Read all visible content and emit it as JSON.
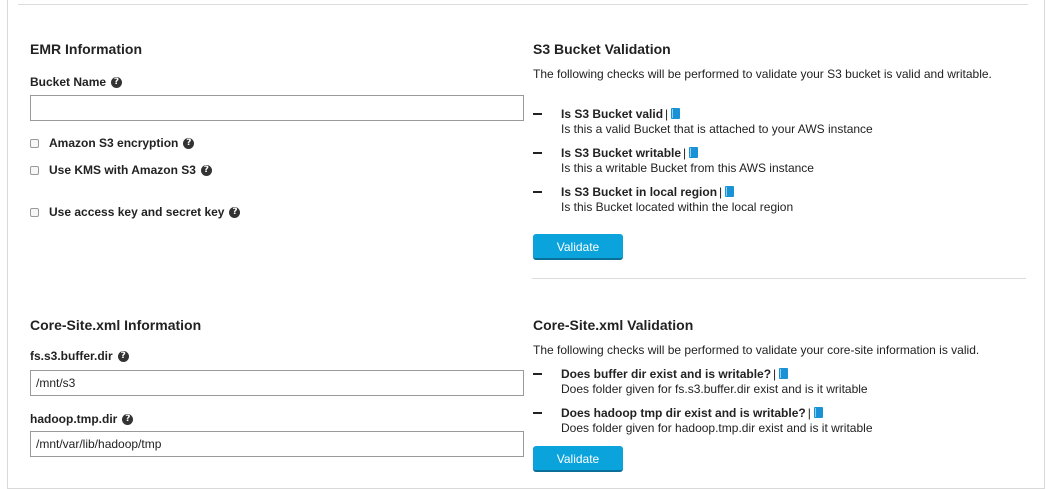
{
  "emr": {
    "title": "EMR Information",
    "bucket_name_label": "Bucket Name",
    "bucket_name_value": "",
    "checkboxes": [
      {
        "label": "Amazon S3 encryption",
        "checked": false
      },
      {
        "label": "Use KMS with Amazon S3",
        "checked": false
      },
      {
        "label": "Use access key and secret key",
        "checked": false
      }
    ]
  },
  "s3_validation": {
    "title": "S3 Bucket Validation",
    "intro": "The following checks will be performed to validate your S3 bucket is valid and writable.",
    "checks": [
      {
        "title": "Is S3 Bucket valid",
        "desc": "Is this a valid Bucket that is attached to your AWS instance"
      },
      {
        "title": "Is S3 Bucket writable",
        "desc": "Is this a writable Bucket from this AWS instance"
      },
      {
        "title": "Is S3 Bucket in local region",
        "desc": "Is this Bucket located within the local region"
      }
    ],
    "button": "Validate"
  },
  "core_site": {
    "title": "Core-Site.xml Information",
    "buffer_label": "fs.s3.buffer.dir",
    "buffer_value": "/mnt/s3",
    "tmp_label": "hadoop.tmp.dir",
    "tmp_value": "/mnt/var/lib/hadoop/tmp"
  },
  "core_validation": {
    "title": "Core-Site.xml Validation",
    "intro": "The following checks will be performed to validate your core-site information is valid.",
    "checks": [
      {
        "title": "Does buffer dir exist and is writable?",
        "desc": "Does folder given for fs.s3.buffer.dir exist and is it writable"
      },
      {
        "title": "Does hadoop tmp dir exist and is writable?",
        "desc": "Does folder given for hadoop.tmp.dir exist and is it writable"
      }
    ],
    "button": "Validate"
  },
  "icons": {
    "help": "help-circle-icon",
    "doc": "book-icon",
    "check_bullet": "dash-icon"
  },
  "colors": {
    "button": "#0aa3dc",
    "doc_icon": "#1a93d6"
  }
}
